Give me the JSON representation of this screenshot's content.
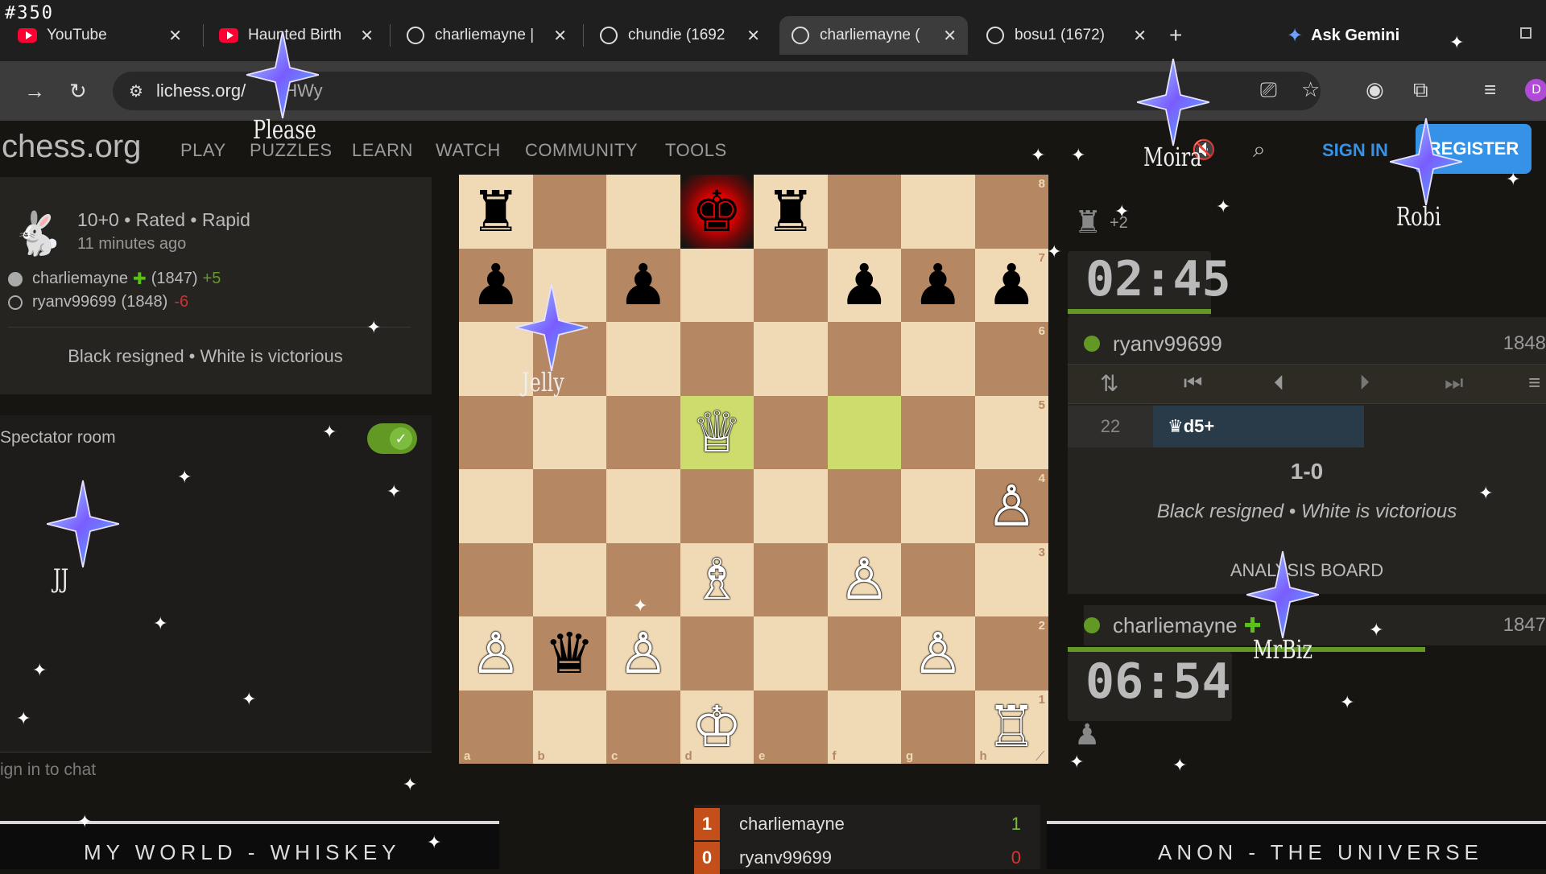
{
  "episode": "#350",
  "tabs": [
    {
      "label": "YouTube",
      "icon": "youtube-icon"
    },
    {
      "label": "Haunted Birth",
      "icon": "youtube-icon"
    },
    {
      "label": "charliemayne |",
      "icon": "lichess-icon"
    },
    {
      "label": "chundie (1692",
      "icon": "lichess-icon"
    },
    {
      "label": "charliemayne (",
      "icon": "lichess-icon",
      "active": true
    },
    {
      "label": "bosu1 (1672)",
      "icon": "lichess-icon"
    }
  ],
  "ask_gemini": "Ask Gemini",
  "url": "lichess.org/",
  "url_tail": "HWy",
  "site": {
    "logo_text": "chess.org",
    "nav": [
      "PLAY",
      "PUZZLES",
      "LEARN",
      "WATCH",
      "COMMUNITY",
      "TOOLS"
    ],
    "sign_in": "SIGN IN",
    "register": "REGISTER"
  },
  "game_info": {
    "format": "10+0 • Rated • Rapid",
    "time_ago": "11 minutes ago",
    "white": {
      "name": "charliemayne",
      "rating": "(1847)",
      "diff": "+5"
    },
    "black": {
      "name": "ryanv99699",
      "rating": "(1848)",
      "diff": "-6"
    },
    "result_text": "Black resigned • White is victorious"
  },
  "spectator_room": "Spectator room",
  "chat_placeholder": "ign in to chat",
  "right": {
    "material": "+2",
    "top_clock": "02:45",
    "top_player": "ryanv99699",
    "top_rating": "1848",
    "move_number": "22",
    "move": "♛d5+",
    "score": "1-0",
    "result_text": "Black resigned • White is victorious",
    "analysis": "ANALYSIS BOARD",
    "bottom_player": "charliemayne",
    "bottom_rating": "1847",
    "bottom_clock": "06:54"
  },
  "scoreboard": [
    {
      "rank": "1",
      "name": "charliemayne",
      "score": "1"
    },
    {
      "rank": "0",
      "name": "ryanv99699",
      "score": "0"
    }
  ],
  "banners": {
    "left": "MY WORLD - WHISKEY",
    "right": "ANON - THE UNIVERSE"
  },
  "star_names": [
    "Please",
    "Moira",
    "Robi",
    "Jelly",
    "JJ",
    "MrBiz"
  ],
  "board": {
    "ranks": [
      [
        "♜",
        "",
        "",
        "♚",
        "♜",
        "",
        "",
        ""
      ],
      [
        "♟",
        "",
        "♟",
        "",
        "",
        "♟",
        "♟",
        "♟"
      ],
      [
        "",
        "",
        "",
        "",
        "",
        "",
        "",
        ""
      ],
      [
        "",
        "",
        "",
        "♕",
        "",
        "",
        "",
        ""
      ],
      [
        "",
        "",
        "",
        "",
        "",
        "",
        "",
        "♙"
      ],
      [
        "",
        "",
        "",
        "♗",
        "",
        "♙",
        "",
        ""
      ],
      [
        "♙",
        "♛",
        "♙",
        "",
        "",
        "",
        "♙",
        ""
      ],
      [
        "",
        "",
        "",
        "♔",
        "",
        "",
        "",
        "♖"
      ]
    ],
    "white_pieces": "♔♕♖♗♘♙",
    "files": [
      "a",
      "b",
      "c",
      "d",
      "e",
      "f",
      "g",
      "h"
    ],
    "rank_labels": [
      "8",
      "7",
      "6",
      "5",
      "4",
      "3",
      "2",
      "1"
    ],
    "highlight": [
      "d5",
      "f5"
    ],
    "check": "d8"
  }
}
